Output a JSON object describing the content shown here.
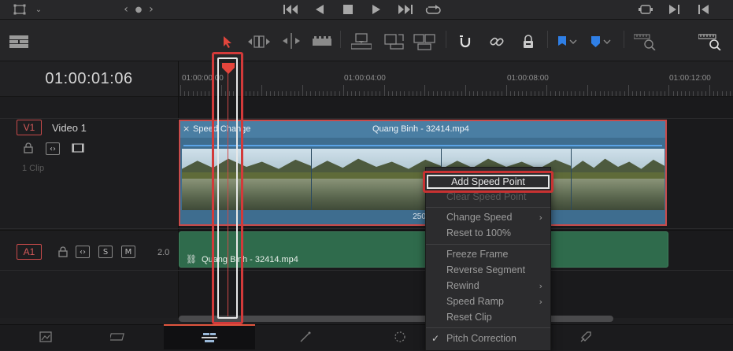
{
  "timecode": "01:00:01:06",
  "ruler": {
    "labels": [
      "01:00:00:00",
      "01:00:04:00",
      "01:00:08:00",
      "01:00:12:00"
    ]
  },
  "video_track": {
    "tag": "V1",
    "name": "Video 1",
    "clip_count": "1 Clip",
    "clip": {
      "effect_label": "Speed Change",
      "title": "Quang Binh - 32414.mp4",
      "speed_percent": "250%"
    }
  },
  "audio_track": {
    "tag": "A1",
    "solo": "S",
    "mute": "M",
    "channels": "2.0",
    "clip_title": "Quang Binh - 32414.mp4"
  },
  "context_menu": {
    "items": [
      {
        "label": "Add Speed Point",
        "enabled": true,
        "highlighted": true
      },
      {
        "label": "Clear Speed Point",
        "enabled": false
      },
      {
        "label": "Change Speed",
        "enabled": true,
        "submenu": true
      },
      {
        "label": "Reset to 100%",
        "enabled": true
      },
      {
        "label": "Freeze Frame",
        "enabled": true
      },
      {
        "label": "Reverse Segment",
        "enabled": true
      },
      {
        "label": "Rewind",
        "enabled": true,
        "submenu": true
      },
      {
        "label": "Speed Ramp",
        "enabled": true,
        "submenu": true
      },
      {
        "label": "Reset Clip",
        "enabled": true
      },
      {
        "label": "Pitch Correction",
        "enabled": true,
        "checked": true
      }
    ]
  },
  "icons": {
    "top": [
      "viewer-mode-icon",
      "chevron-down-icon",
      "prev-nav-icon",
      "dot-icon",
      "next-nav-icon",
      "skip-to-start-icon",
      "play-reverse-icon",
      "stop-icon",
      "play-icon",
      "skip-to-end-icon",
      "loop-icon",
      "match-frame-icon",
      "next-edit-icon",
      "prev-edit-icon"
    ],
    "toolbar": [
      "timeline-view-options-icon",
      "selection-arrow-icon",
      "trim-edit-icon",
      "dynamic-trim-icon",
      "blade-icon",
      "insert-clip-icon",
      "overwrite-clip-icon",
      "replace-clip-icon",
      "snapping-icon",
      "linked-selection-icon",
      "position-lock-icon",
      "flag-icon",
      "marker-icon",
      "zoom-out-icon",
      "zoom-in-icon"
    ],
    "pages": [
      "media-page-icon",
      "cut-page-icon",
      "edit-page-icon",
      "fusion-page-icon",
      "color-page-icon",
      "fairlight-page-icon",
      "deliver-page-icon"
    ]
  },
  "colors": {
    "playhead": "#d04848",
    "highlight_box": "#c93232",
    "video_clip": "#3e6d8f",
    "audio_clip": "#2f6b4c",
    "active_page": "#e0553e"
  }
}
